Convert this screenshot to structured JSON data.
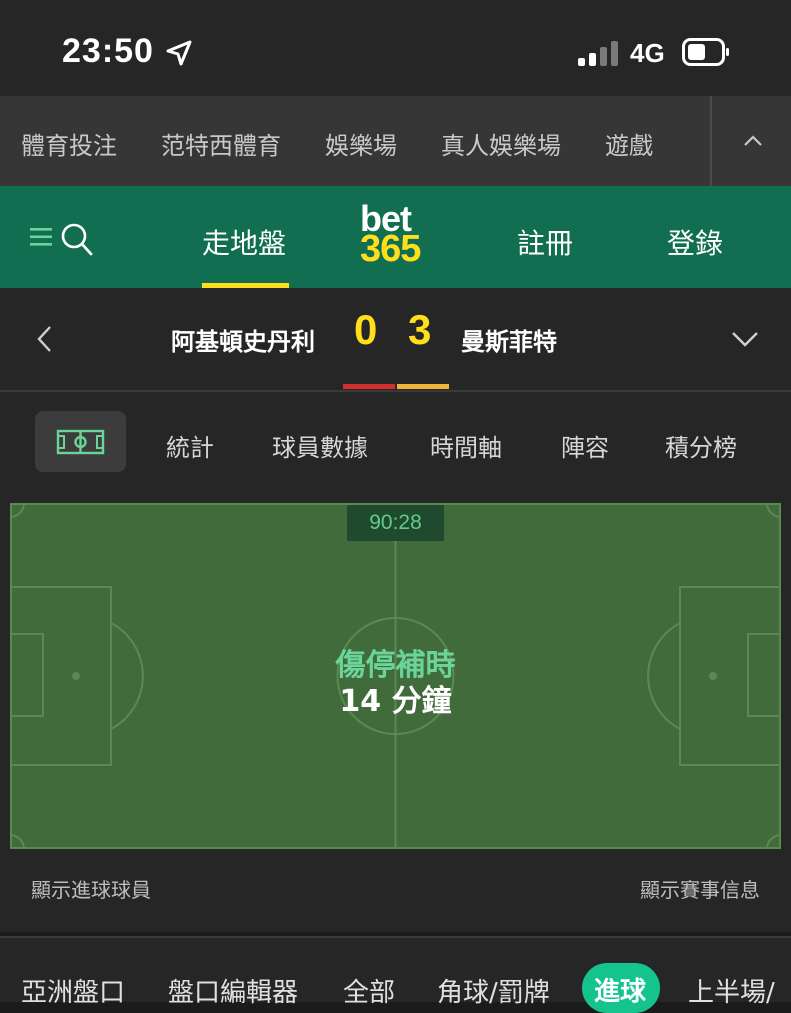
{
  "status_bar": {
    "time": "23:50",
    "network": "4G"
  },
  "top_nav": {
    "items": [
      "體育投注",
      "范特西體育",
      "娛樂場",
      "真人娛樂場",
      "遊戲"
    ]
  },
  "header": {
    "items": [
      "走地盤",
      "註冊",
      "登錄"
    ],
    "logo_top": "bet",
    "logo_bottom": "365",
    "accent": "#126e51",
    "brand_yellow": "#ffdf1b"
  },
  "scoreboard": {
    "home_team": "阿基頓史丹利",
    "home_score": "0",
    "away_score": "3",
    "away_team": "曼斯菲特",
    "home_color": "#d42f2f",
    "away_color": "#f2b53b"
  },
  "match_tabs": [
    "統計",
    "球員數據",
    "時間軸",
    "陣容",
    "積分榜"
  ],
  "pitch": {
    "clock": "90:28",
    "status_label": "傷停補時",
    "status_value": "14 分鐘"
  },
  "links": {
    "left": "顯示進球球員",
    "right": "顯示賽事信息"
  },
  "market_tabs": [
    "亞洲盤口",
    "盤口編輯器",
    "全部",
    "角球/罰牌",
    "進球",
    "上半場/"
  ],
  "market_active": "進球"
}
